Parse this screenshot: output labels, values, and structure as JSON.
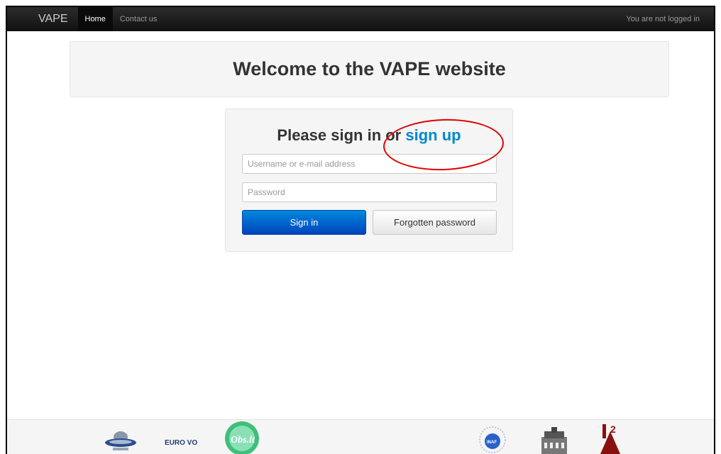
{
  "navbar": {
    "brand": "VAPE",
    "links": [
      {
        "label": "Home",
        "active": true
      },
      {
        "label": "Contact us",
        "active": false
      }
    ],
    "status": "You are not logged in"
  },
  "hero": {
    "title": "Welcome to the VAPE website"
  },
  "signin": {
    "title_prefix": "Please sign in or ",
    "title_link": "sign up",
    "username_placeholder": "Username or e-mail address",
    "password_placeholder": "Password",
    "sign_in_label": "Sign in",
    "forgot_label": "Forgotten password"
  },
  "colors": {
    "navbar": "#1b1b1b",
    "link": "#0088cc",
    "primary_button": "#0066cc",
    "annotation": "#e00000"
  },
  "footer": {
    "logos": [
      "ufo-logo",
      "euro-vo-logo",
      "obs-it-logo",
      "inaf-logo",
      "observatory-building-logo",
      "ia2-logo"
    ],
    "euro_vo_text": "EURO VO",
    "obs_text": "Obs.it",
    "inaf_text": "INAF",
    "ia2_text": "IA2"
  }
}
